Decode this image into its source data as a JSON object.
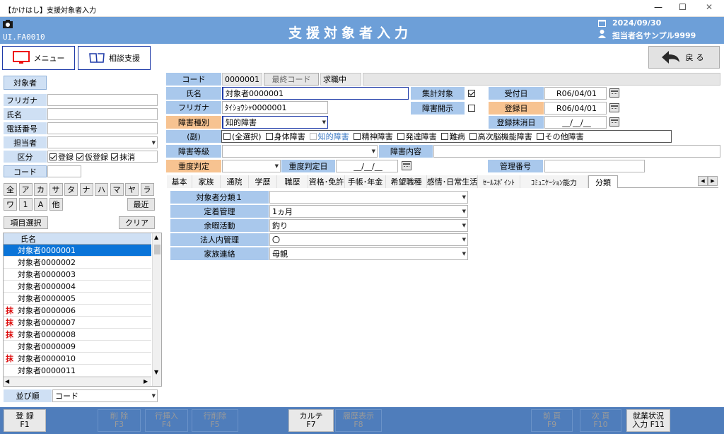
{
  "window": {
    "title": "【かけはし】支援対象者入力",
    "minimize": "—",
    "maximize": "☐",
    "close": "✕"
  },
  "header": {
    "screen_id": "UI.FA0010",
    "title": "支援対象者入力",
    "date": "2024/09/30",
    "user": "担当者名サンプル9999"
  },
  "toolbar": {
    "menu": "メニュー",
    "consult": "相談支援",
    "back": "戻る"
  },
  "search": {
    "target_btn": "対象者",
    "furigana": "フリガナ",
    "name": "氏名",
    "phone": "電話番号",
    "staff": "担当者",
    "category": "区分",
    "reg": "登録",
    "tmp": "仮登録",
    "del": "抹消",
    "code": "コード",
    "kana_row1": [
      "全",
      "ア",
      "カ",
      "サ",
      "タ",
      "ナ",
      "ハ",
      "マ",
      "ヤ",
      "ラ"
    ],
    "kana_row2": [
      "ワ",
      "1",
      "A",
      "他"
    ],
    "recent": "最近",
    "item_select": "項目選択",
    "clear": "クリア",
    "col_name": "氏名",
    "rows": [
      {
        "mark": "",
        "name": "対象者0000001"
      },
      {
        "mark": "",
        "name": "対象者0000002"
      },
      {
        "mark": "",
        "name": "対象者0000003"
      },
      {
        "mark": "",
        "name": "対象者0000004"
      },
      {
        "mark": "",
        "name": "対象者0000005"
      },
      {
        "mark": "抹",
        "name": "対象者0000006"
      },
      {
        "mark": "抹",
        "name": "対象者0000007"
      },
      {
        "mark": "抹",
        "name": "対象者0000008"
      },
      {
        "mark": "",
        "name": "対象者0000009"
      },
      {
        "mark": "抹",
        "name": "対象者0000010"
      },
      {
        "mark": "",
        "name": "対象者0000011"
      }
    ],
    "sort_label": "並び順",
    "sort_value": "コード"
  },
  "form": {
    "code_label": "コード",
    "code_value": "0000001",
    "last_code": "最終コード",
    "status": "求職中",
    "name_label": "氏名",
    "name_value": "対象者0000001",
    "furigana_label": "フリガナ",
    "furigana_value": "ﾀｲｼｮｳｼｬ0000001",
    "dtype_label": "障害種別",
    "dtype_value": "知的障害",
    "sub_label": "(副)",
    "sub_items": [
      "(全選択)",
      "身体障害",
      "知的障害",
      "精神障害",
      "発達障害",
      "難病",
      "高次脳機能障害",
      "その他障害"
    ],
    "grade_label": "障害等級",
    "content_label": "障害内容",
    "severity_label": "重度判定",
    "severity_date_label": "重度判定日",
    "severity_date_value": "__/__/__",
    "mgmt_label": "管理番号",
    "agg_label": "集計対象",
    "disclose_label": "障害開示",
    "recv_label": "受付日",
    "recv_value": "R06/04/01",
    "reg_label": "登録日",
    "reg_value": "R06/04/01",
    "delete_label": "登録抹消日",
    "delete_value": "__/__/__"
  },
  "tabs": [
    "基本",
    "家族",
    "通院",
    "学歴",
    "職歴",
    "資格･免許",
    "手帳･年金",
    "希望職種",
    "感情･日常生活",
    "ｾｰﾙｽﾎﾟｲﾝﾄ",
    "ｺﾐｭﾆｹｰｼｮﾝ能力",
    "分類"
  ],
  "classify": [
    {
      "label": "対象者分類１",
      "value": ""
    },
    {
      "label": "定着管理",
      "value": "1ヵ月"
    },
    {
      "label": "余暇活動",
      "value": "釣り"
    },
    {
      "label": "法人内管理",
      "value": "〇"
    },
    {
      "label": "家族連絡",
      "value": "母親"
    }
  ],
  "fkeys": [
    {
      "l1": "登 録",
      "l2": "F1"
    },
    {
      "l1": "削 除",
      "l2": "F3"
    },
    {
      "l1": "行挿入",
      "l2": "F4"
    },
    {
      "l1": "行削除",
      "l2": "F5"
    },
    {
      "l1": "カルテ",
      "l2": "F7"
    },
    {
      "l1": "履歴表示",
      "l2": "F8"
    },
    {
      "l1": "前 頁",
      "l2": "F9"
    },
    {
      "l1": "次 頁",
      "l2": "F10"
    },
    {
      "l1": "就業状況",
      "l2": "入力 F11"
    }
  ]
}
